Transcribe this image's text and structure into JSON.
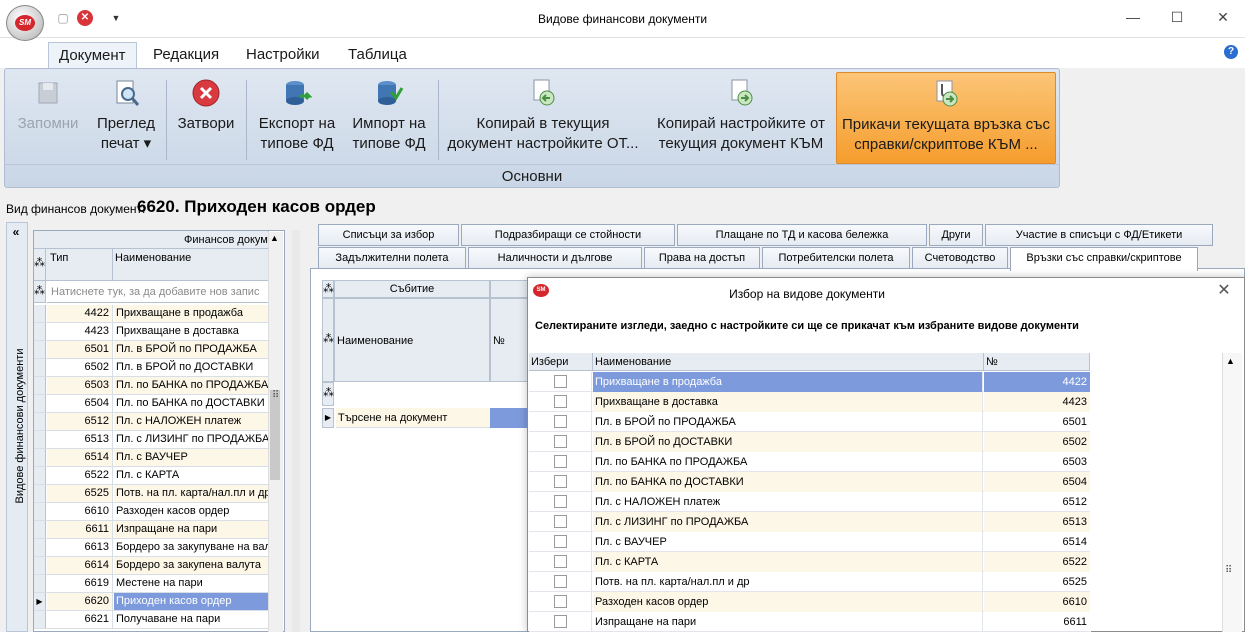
{
  "window": {
    "title": "Видове финансови документи",
    "minimize": "—",
    "maximize": "☐",
    "close": "✕"
  },
  "qat": {
    "save_icon": "save-icon",
    "close_icon": "close-icon",
    "dropdown": "▼"
  },
  "logo": {
    "text": "SM"
  },
  "menu": {
    "tabs": [
      "Документ",
      "Редакция",
      "Настройки",
      "Таблица"
    ],
    "help": "?"
  },
  "ribbon": {
    "group_label": "Основни",
    "buttons": [
      {
        "line1": "Запомни",
        "line2": "",
        "icon": "save-icon",
        "enabled": false
      },
      {
        "line1": "Преглед",
        "line2": "печат ▾",
        "icon": "print-preview-icon",
        "enabled": true
      },
      {
        "line1": "Затвори",
        "line2": "",
        "icon": "close-icon",
        "enabled": true
      },
      {
        "line1": "Експорт на",
        "line2": "типове ФД",
        "icon": "export-db-icon",
        "enabled": true
      },
      {
        "line1": "Импорт на",
        "line2": "типове ФД",
        "icon": "import-db-icon",
        "enabled": true
      },
      {
        "line1": "Копирай в текущия",
        "line2": "документ настройките ОТ...",
        "icon": "copy-document-icon",
        "enabled": true
      },
      {
        "line1": "Копирай настройките от",
        "line2": "текущия документ КЪМ",
        "icon": "copy-document-icon",
        "enabled": true
      },
      {
        "line1": "Прикачи текущата връзка със",
        "line2": "справки/скриптове КЪМ ...",
        "icon": "attach-document-icon",
        "enabled": true
      }
    ]
  },
  "doc_type": {
    "label": "Вид финансов документ:",
    "value": "6620. Приходен касов ордер"
  },
  "sidebar": {
    "label": "Видове финансови документи",
    "collapse": "«"
  },
  "left_grid": {
    "group_header": "Финансов документ",
    "col_type": "Тип",
    "col_name": "Наименование",
    "new_row_hint": "Натиснете тук, за да добавите нов запис",
    "rows": [
      {
        "code": "4422",
        "name": "Прихващане в продажба"
      },
      {
        "code": "4423",
        "name": "Прихващане в доставка"
      },
      {
        "code": "6501",
        "name": "Пл. в БРОЙ по ПРОДАЖБА"
      },
      {
        "code": "6502",
        "name": "Пл. в БРОЙ по ДОСТАВКИ"
      },
      {
        "code": "6503",
        "name": "Пл. по БАНКА по ПРОДАЖБА"
      },
      {
        "code": "6504",
        "name": "Пл. по БАНКА по ДОСТАВКИ"
      },
      {
        "code": "6512",
        "name": "Пл. с НАЛОЖЕН платеж"
      },
      {
        "code": "6513",
        "name": "Пл. с ЛИЗИНГ по ПРОДАЖБА"
      },
      {
        "code": "6514",
        "name": "Пл. с ВАУЧЕР"
      },
      {
        "code": "6522",
        "name": "Пл. с КАРТА"
      },
      {
        "code": "6525",
        "name": "Потв. на пл. карта/нал.пл и др"
      },
      {
        "code": "6610",
        "name": "Разходен касов ордер"
      },
      {
        "code": "6611",
        "name": "Изпращане на пари"
      },
      {
        "code": "6613",
        "name": "Бордеро за закупуване на валута"
      },
      {
        "code": "6614",
        "name": "Бордеро за закупена валута"
      },
      {
        "code": "6619",
        "name": "Местене на пари"
      },
      {
        "code": "6620",
        "name": "Приходен касов ордер"
      },
      {
        "code": "6621",
        "name": "Получаване на пари"
      }
    ],
    "selected_index": 16
  },
  "tabs_row1": [
    "Списъци за избор",
    "Подразбиращи се стойности",
    "Плащане по ТД и касова бележка",
    "Други",
    "Участие в списъци с ФД/Етикети"
  ],
  "tabs_row2": [
    "Задължителни полета",
    "Наличности и дългове",
    "Права на достъп",
    "Потребителски полета",
    "Счетоводство",
    "Връзки със справки/скриптове"
  ],
  "events_grid": {
    "group_header": "Събитие",
    "col_name": "Наименование",
    "col_num": "№",
    "row": "Търсене на документ"
  },
  "dialog": {
    "title": "Избор на видове документи",
    "close": "✕",
    "instruction": "Селектираните изгледи, заедно с настройките си ще се прикачат към избраните видове документи",
    "col_select": "Избери",
    "col_name": "Наименование",
    "col_num": "№",
    "rows": [
      {
        "name": "Прихващане в продажба",
        "num": "4422"
      },
      {
        "name": "Прихващане в доставка",
        "num": "4423"
      },
      {
        "name": "Пл. в БРОЙ по ПРОДАЖБА",
        "num": "6501"
      },
      {
        "name": "Пл. в БРОЙ по ДОСТАВКИ",
        "num": "6502"
      },
      {
        "name": "Пл. по БАНКА по ПРОДАЖБА",
        "num": "6503"
      },
      {
        "name": "Пл. по БАНКА по ДОСТАВКИ",
        "num": "6504"
      },
      {
        "name": "Пл. с НАЛОЖЕН платеж",
        "num": "6512"
      },
      {
        "name": "Пл. с ЛИЗИНГ по ПРОДАЖБА",
        "num": "6513"
      },
      {
        "name": "Пл. с ВАУЧЕР",
        "num": "6514"
      },
      {
        "name": "Пл. с КАРТА",
        "num": "6522"
      },
      {
        "name": "Потв. на пл. карта/нал.пл и др",
        "num": "6525"
      },
      {
        "name": "Разходен касов ордер",
        "num": "6610"
      },
      {
        "name": "Изпращане на пари",
        "num": "6611"
      }
    ],
    "selected_index": 0
  }
}
